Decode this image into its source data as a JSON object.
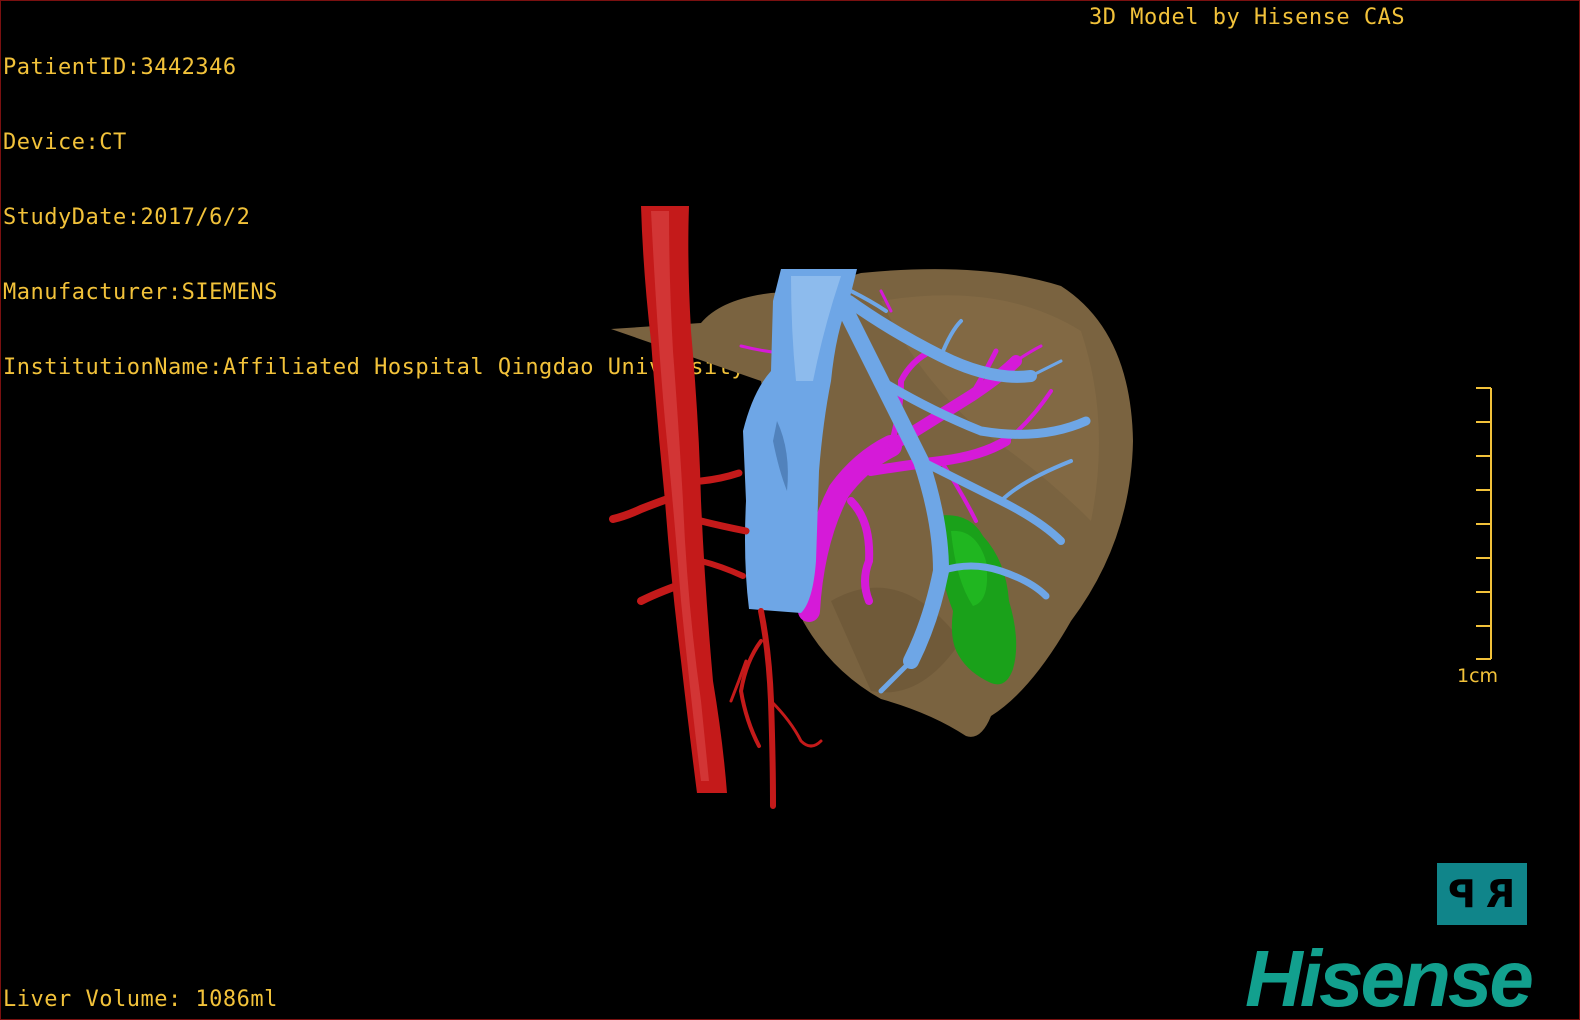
{
  "patient_info": {
    "patient_id": "PatientID:3442346",
    "device": "Device:CT",
    "study_date": "StudyDate:2017/6/2",
    "manufacturer": "Manufacturer:SIEMENS",
    "institution": "InstitutionName:Affiliated Hospital Qingdao University-C"
  },
  "credit": "3D Model by Hisense CAS",
  "liver_volume": "Liver Volume: 1086ml",
  "scale": {
    "label": "1cm"
  },
  "orientation": {
    "left_glyph": "P",
    "right_glyph": "R"
  },
  "brand": "Hisense",
  "colors": {
    "overlay_text": "#f2c23a",
    "artery": "#c41a1a",
    "vena_cava": "#6ea6e6",
    "portal_vein": "#d51ad8",
    "liver": "#7a6340",
    "lesion": "#1aa11a",
    "brand": "#12a08e"
  },
  "icons": {
    "orientation": "orientation-cube-icon",
    "scale": "scale-bar-icon"
  }
}
